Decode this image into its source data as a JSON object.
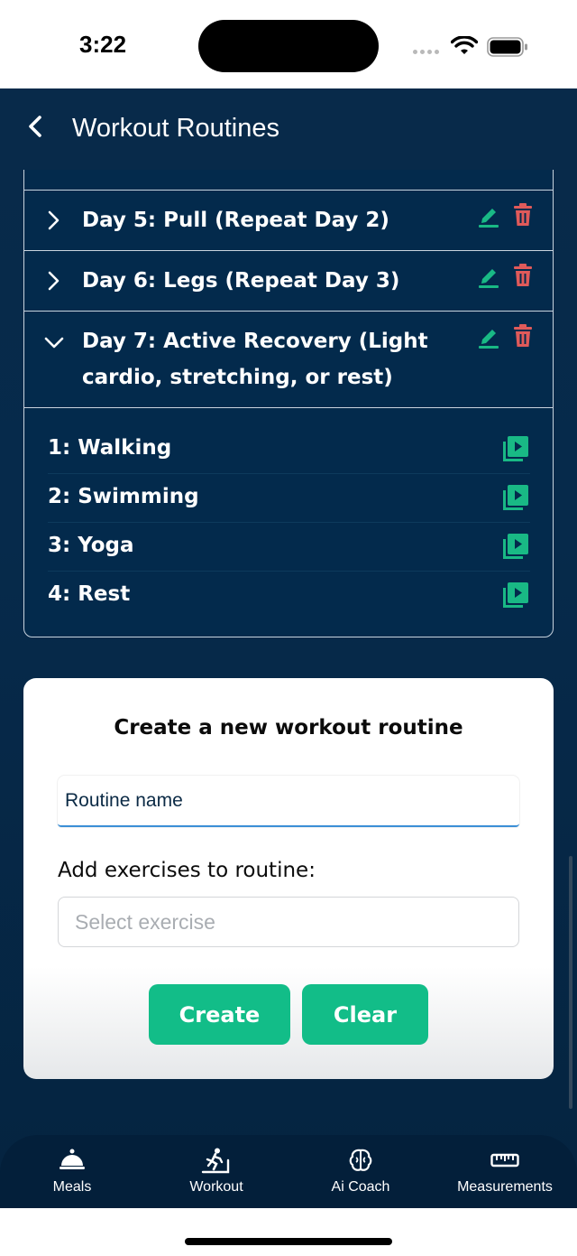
{
  "status_bar": {
    "time": "3:22"
  },
  "header": {
    "title": "Workout Routines"
  },
  "routine_days": [
    {
      "label": "Day 5: Pull (Repeat Day 2)",
      "expanded": false
    },
    {
      "label": "Day 6: Legs (Repeat Day 3)",
      "expanded": false
    },
    {
      "label": "Day 7: Active Recovery (Light cardio, stretching, or rest)",
      "expanded": true
    }
  ],
  "exercises": [
    {
      "label": "1:  Walking"
    },
    {
      "label": "2:  Swimming"
    },
    {
      "label": "3:  Yoga"
    },
    {
      "label": "4:  Rest"
    }
  ],
  "create_form": {
    "title": "Create a new workout routine",
    "name_value": "Routine name",
    "add_label": "Add exercises to routine:",
    "select_placeholder": "Select exercise",
    "create_label": "Create",
    "clear_label": "Clear"
  },
  "tabs": [
    {
      "label": "Meals",
      "icon": "meal-cloche-icon"
    },
    {
      "label": "Workout",
      "icon": "treadmill-runner-icon"
    },
    {
      "label": "Ai Coach",
      "icon": "brain-icon"
    },
    {
      "label": "Measurements",
      "icon": "ruler-icon"
    }
  ],
  "colors": {
    "background": "#062a4b",
    "accent_green": "#12bd88",
    "delete_red": "#e05a5a",
    "edit_green": "#19b985"
  }
}
